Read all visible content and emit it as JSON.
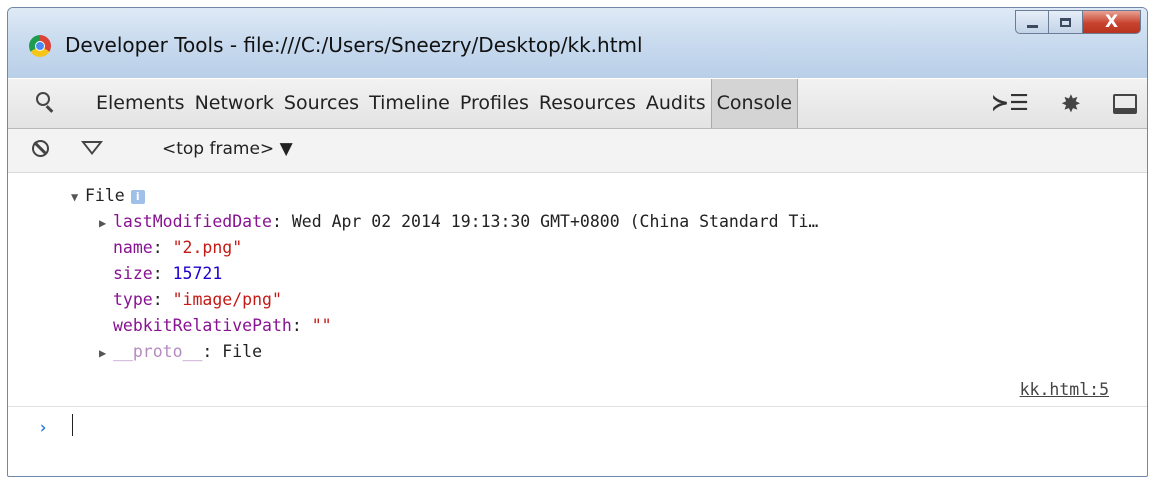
{
  "window": {
    "title": "Developer Tools - file:///C:/Users/Sneezry/Desktop/kk.html",
    "close_label": "X"
  },
  "toolbar": {
    "tabs": [
      "Elements",
      "Network",
      "Sources",
      "Timeline",
      "Profiles",
      "Resources",
      "Audits",
      "Console"
    ],
    "active_tab": "Console",
    "drawer_glyph": "≻☰",
    "gear_glyph": "✸"
  },
  "subbar": {
    "frame_select": "<top frame> ▼"
  },
  "console": {
    "object_label": "File",
    "info_glyph": "i",
    "expand_glyph": "▼",
    "collapse_glyph": "▶",
    "lastModifiedDate": {
      "key": "lastModifiedDate",
      "value": "Wed Apr 02 2014 19:13:30 GMT+0800 (China Standard Ti…"
    },
    "name": {
      "key": "name",
      "value": "\"2.png\""
    },
    "size": {
      "key": "size",
      "value": "15721"
    },
    "type": {
      "key": "type",
      "value": "\"image/png\""
    },
    "webkitRelativePath": {
      "key": "webkitRelativePath",
      "value": "\"\""
    },
    "proto": {
      "key": "__proto__",
      "value": "File"
    },
    "colon": ": ",
    "source_link": "kk.html:5",
    "prompt_glyph": "›"
  },
  "colors": {
    "property": "#881391",
    "string": "#c41a16",
    "number": "#1c00cf",
    "prompt": "#2f7fd5"
  }
}
